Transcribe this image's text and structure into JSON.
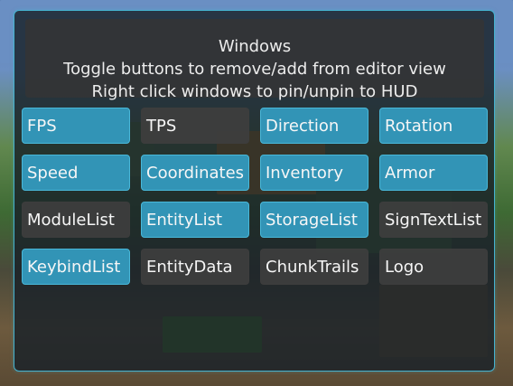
{
  "panel": {
    "title": "Windows",
    "instruction_line1": "Toggle buttons to remove/add from editor view",
    "instruction_line2": "Right click windows to pin/unpin to HUD"
  },
  "colors": {
    "accent": "#3294b6",
    "border": "#45b3d0",
    "off": "#3e3e3e"
  },
  "window_buttons": [
    {
      "label": "FPS",
      "active": true
    },
    {
      "label": "TPS",
      "active": false
    },
    {
      "label": "Direction",
      "active": true
    },
    {
      "label": "Rotation",
      "active": true
    },
    {
      "label": "Speed",
      "active": true
    },
    {
      "label": "Coordinates",
      "active": true
    },
    {
      "label": "Inventory",
      "active": true
    },
    {
      "label": "Armor",
      "active": true
    },
    {
      "label": "ModuleList",
      "active": false
    },
    {
      "label": "EntityList",
      "active": true
    },
    {
      "label": "StorageList",
      "active": true
    },
    {
      "label": "SignTextList",
      "active": false
    },
    {
      "label": "KeybindList",
      "active": true
    },
    {
      "label": "EntityData",
      "active": false
    },
    {
      "label": "ChunkTrails",
      "active": false
    },
    {
      "label": "Logo",
      "active": false
    }
  ]
}
